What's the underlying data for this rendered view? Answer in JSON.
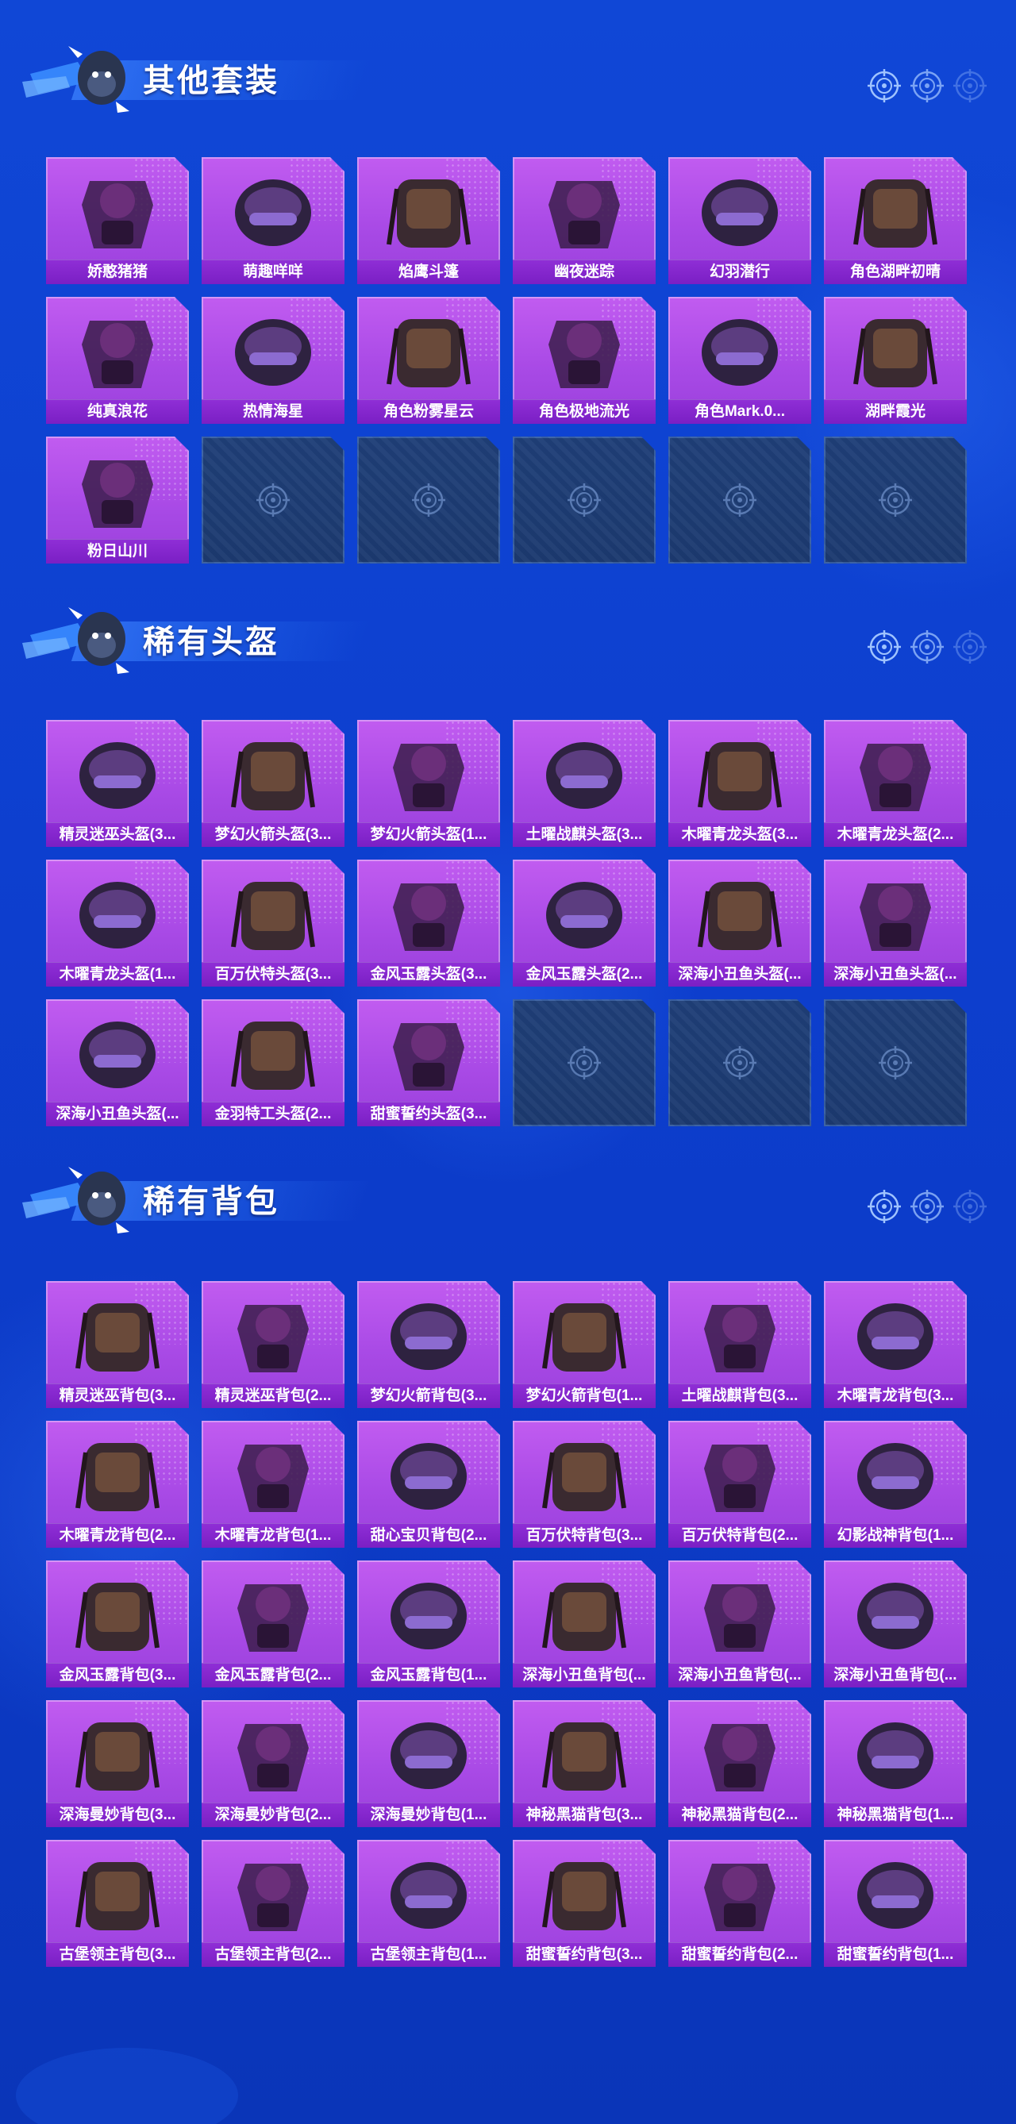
{
  "colors": {
    "background": "#0d3fcf",
    "card_purple": "#a94ae6",
    "label_bar": "#7a1fc4",
    "empty_slot": "#1f3f78"
  },
  "sections": [
    {
      "title": "其他套装",
      "icons": [
        "mascot-icon",
        "crosshair-icon"
      ],
      "items": [
        "娇憨猪猪",
        "萌趣咩咩",
        "焰鹰斗篷",
        "幽夜迷踪",
        "幻羽潜行",
        "角色湖畔初晴",
        "纯真浪花",
        "热情海星",
        "角色粉雾星云",
        "角色极地流光",
        "角色Mark.0...",
        "湖畔霞光",
        "粉日山川"
      ],
      "empty_slots": 5
    },
    {
      "title": "稀有头盔",
      "icons": [
        "mascot-icon",
        "crosshair-icon"
      ],
      "items": [
        "精灵迷巫头盔(3...",
        "梦幻火箭头盔(3...",
        "梦幻火箭头盔(1...",
        "土曜战麒头盔(3...",
        "木曜青龙头盔(3...",
        "木曜青龙头盔(2...",
        "木曜青龙头盔(1...",
        "百万伏特头盔(3...",
        "金风玉露头盔(3...",
        "金风玉露头盔(2...",
        "深海小丑鱼头盔(...",
        "深海小丑鱼头盔(...",
        "深海小丑鱼头盔(...",
        "金羽特工头盔(2...",
        "甜蜜誓约头盔(3..."
      ],
      "empty_slots": 3
    },
    {
      "title": "稀有背包",
      "icons": [
        "mascot-icon",
        "crosshair-icon"
      ],
      "items": [
        "精灵迷巫背包(3...",
        "精灵迷巫背包(2...",
        "梦幻火箭背包(3...",
        "梦幻火箭背包(1...",
        "土曜战麒背包(3...",
        "木曜青龙背包(3...",
        "木曜青龙背包(2...",
        "木曜青龙背包(1...",
        "甜心宝贝背包(2...",
        "百万伏特背包(3...",
        "百万伏特背包(2...",
        "幻影战神背包(1...",
        "金风玉露背包(3...",
        "金风玉露背包(2...",
        "金风玉露背包(1...",
        "深海小丑鱼背包(...",
        "深海小丑鱼背包(...",
        "深海小丑鱼背包(...",
        "深海曼妙背包(3...",
        "深海曼妙背包(2...",
        "深海曼妙背包(1...",
        "神秘黑猫背包(3...",
        "神秘黑猫背包(2...",
        "神秘黑猫背包(1...",
        "古堡领主背包(3...",
        "古堡领主背包(2...",
        "古堡领主背包(1...",
        "甜蜜誓约背包(3...",
        "甜蜜誓约背包(2...",
        "甜蜜誓约背包(1..."
      ],
      "empty_slots": 0
    }
  ]
}
